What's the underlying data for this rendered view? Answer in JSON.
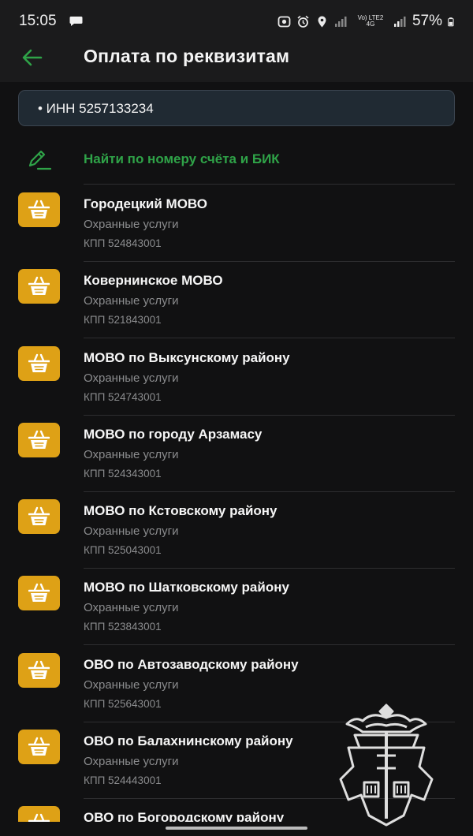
{
  "status_bar": {
    "time": "15:05",
    "network": "Vo) LTE2 4G",
    "battery": "57%"
  },
  "header": {
    "title": "Оплата по реквизитам"
  },
  "search": {
    "value": "• ИНН 5257133234"
  },
  "find_by_account": {
    "label": "Найти по номеру счёта и БИК"
  },
  "colors": {
    "accent_green": "#2fa348",
    "org_icon_bg": "#dea116",
    "background": "#111112"
  },
  "organizations": [
    {
      "name": "Городецкий МОВО",
      "category": "Охранные услуги",
      "kpp": "КПП 524843001",
      "icon": "basket-icon"
    },
    {
      "name": "Ковернинское МОВО",
      "category": "Охранные услуги",
      "kpp": "КПП 521843001",
      "icon": "basket-icon"
    },
    {
      "name": "МОВО по Выксунскому району",
      "category": "Охранные услуги",
      "kpp": "КПП 524743001",
      "icon": "basket-icon"
    },
    {
      "name": "МОВО по городу Арзамасу",
      "category": "Охранные услуги",
      "kpp": "КПП 524343001",
      "icon": "basket-icon"
    },
    {
      "name": "МОВО по Кстовскому району",
      "category": "Охранные услуги",
      "kpp": "КПП 525043001",
      "icon": "basket-icon"
    },
    {
      "name": "МОВО по Шатковскому району",
      "category": "Охранные услуги",
      "kpp": "КПП 523843001",
      "icon": "basket-icon"
    },
    {
      "name": "ОВО по Автозаводскому району",
      "category": "Охранные услуги",
      "kpp": "КПП 525643001",
      "icon": "basket-icon"
    },
    {
      "name": "ОВО по Балахнинскому району",
      "category": "Охранные услуги",
      "kpp": "КПП 524443001",
      "icon": "basket-icon"
    },
    {
      "name": "ОВО по Богородскому району",
      "category": "",
      "kpp": "",
      "icon": "basket-icon"
    }
  ]
}
